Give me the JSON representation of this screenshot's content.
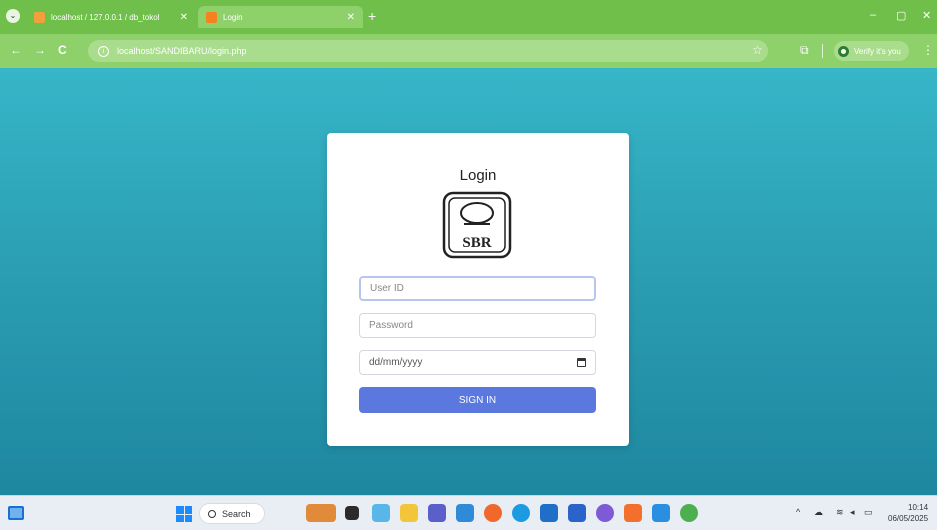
{
  "browser": {
    "tabs": [
      {
        "title": "localhost / 127.0.0.1 / db_tokol",
        "active": false
      },
      {
        "title": "Login",
        "active": true
      }
    ],
    "new_tab": "+",
    "window_controls": {
      "minimize": "–",
      "restore": "▢",
      "close": "✕"
    },
    "nav": {
      "back": "←",
      "forward": "→",
      "reload": "C"
    },
    "url": "localhost/SANDIBARU/login.php",
    "verify_label": "Verify it's you",
    "menu": "⋮"
  },
  "login": {
    "title": "Login",
    "logo_text": "SBR",
    "user_id_placeholder": "User ID",
    "password_placeholder": "Password",
    "date_placeholder": "dd/mm/yyyy",
    "signin_label": "SIGN IN"
  },
  "taskbar": {
    "search_placeholder": "Search",
    "time": "10:14",
    "date": "06/05/2025",
    "tray_chevron": "^"
  },
  "colors": {
    "chrome": "#6fbf4a",
    "page_gradient_top": "#37b6c8",
    "page_gradient_bottom": "#1e87a0",
    "button": "#5a78dd"
  }
}
